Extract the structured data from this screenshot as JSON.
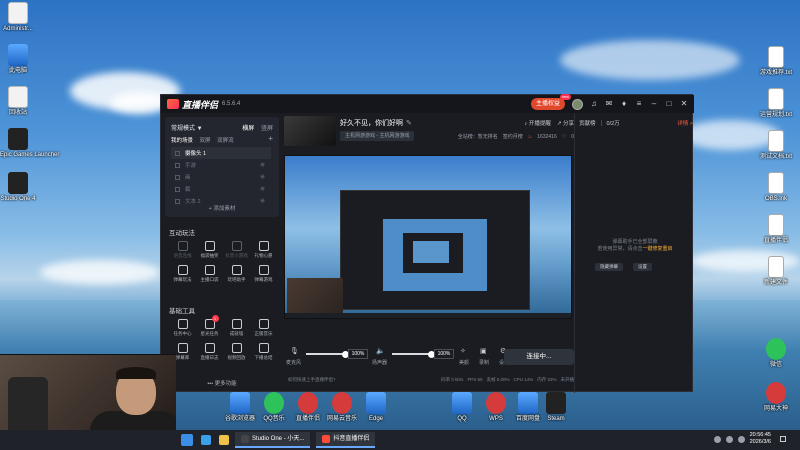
{
  "desktop": {
    "left_icons": [
      {
        "label": "Administr..."
      },
      {
        "label": "此电脑"
      },
      {
        "label": "回收站"
      },
      {
        "label": "Epic Games Launcher"
      },
      {
        "label": "Studio One 4"
      }
    ],
    "right_icons": [
      {
        "label": "游戏推荐.txt"
      },
      {
        "label": "运营规划.txt"
      },
      {
        "label": "测试文档.txt"
      },
      {
        "label": "OBS.lnk"
      },
      {
        "label": "直播伴侣"
      },
      {
        "label": "新建文件"
      },
      {
        "label": "微信"
      },
      {
        "label": "网易大神"
      }
    ],
    "bottom_icons": [
      {
        "label": "谷歌浏览器"
      },
      {
        "label": "QQ音乐"
      },
      {
        "label": "直播伴侣"
      },
      {
        "label": "网易云音乐"
      },
      {
        "label": "Edge"
      },
      {
        "label": "QQ"
      },
      {
        "label": "WPS"
      },
      {
        "label": "百度网盘"
      },
      {
        "label": "Steam"
      }
    ]
  },
  "app": {
    "name": "直播伴侣",
    "version": "6.5.6.4",
    "titlebar": {
      "vip_label": "主播权益",
      "new_tag": "new"
    },
    "left": {
      "mode_label": "常规模式 ▼",
      "orientation_tabs": [
        "横屏",
        "竖屏"
      ],
      "scene_tabs": [
        "我的场景",
        "双屏",
        "双屏流"
      ],
      "scenes": [
        {
          "label": "摄像头 1",
          "active": true
        },
        {
          "label": "手游",
          "active": false
        },
        {
          "label": "画",
          "active": false
        },
        {
          "label": "截",
          "active": false
        },
        {
          "label": "文本 2",
          "active": false
        }
      ],
      "add_source": "+ 添加素材",
      "interactive_title": "互动玩法",
      "interactive_tools": [
        {
          "label": "语音连线",
          "dim": true
        },
        {
          "label": "福袋抽奖",
          "dim": false
        },
        {
          "label": "抖音小游戏",
          "dim": true
        },
        {
          "label": "礼物心愿",
          "dim": false
        },
        {
          "label": "弹幕玩法",
          "dim": false
        },
        {
          "label": "主播口袋",
          "dim": false
        },
        {
          "label": "玩吧助手",
          "dim": false
        },
        {
          "label": "弹幕游戏",
          "dim": false
        }
      ],
      "basic_title": "基础工具",
      "basic_tools": [
        {
          "label": "任务中心",
          "badge": ""
        },
        {
          "label": "星光任务",
          "badge": "1"
        },
        {
          "label": "成就墙",
          "badge": ""
        },
        {
          "label": "正版音乐",
          "badge": ""
        },
        {
          "label": "弹幕库",
          "badge": ""
        },
        {
          "label": "直播日志",
          "badge": ""
        },
        {
          "label": "视频回放",
          "badge": ""
        },
        {
          "label": "下播总结",
          "badge": ""
        }
      ],
      "more_label": "••• 更多功能"
    },
    "center": {
      "room_title": "好久不见，你们好啊",
      "category": "主机网游游戏 - 主机网游游戏",
      "top_actions": [
        "开播提醒",
        "分享"
      ],
      "stats": [
        "全站榜：暂无排名",
        "签约月榜",
        "1632416",
        "0"
      ],
      "mic_label": "麦克风",
      "mic_pct": "100%",
      "speaker_label": "扬声器",
      "speaker_pct": "100%",
      "ctrl_buttons": [
        "美颜",
        "录制",
        "设置"
      ],
      "start_button": "连接中...",
      "tip": "如何快速上手直播伴侣?",
      "metrics": [
        "码率 0 kb/s",
        "FPS 60",
        "丢帧 0.00%",
        "CPU 14%",
        "内存 53%",
        "未开播"
      ]
    },
    "right": {
      "tabs": [
        "贡献榜",
        "0/2万"
      ],
      "rank_label": "详情 >",
      "empty_msg": "弹幕助手已全部屏蔽",
      "hint_msg": "若使用异常，请点击",
      "link_text": "一键修复",
      "link_suffix": "重启",
      "buttons": [
        "隐藏弹幕",
        "设置"
      ]
    }
  },
  "taskbar": {
    "tasks": [
      {
        "label": "Studio One - 小天..."
      },
      {
        "label": "抖音直播伴侣"
      }
    ],
    "time": "20:56:45",
    "date": "2026/3/6"
  }
}
